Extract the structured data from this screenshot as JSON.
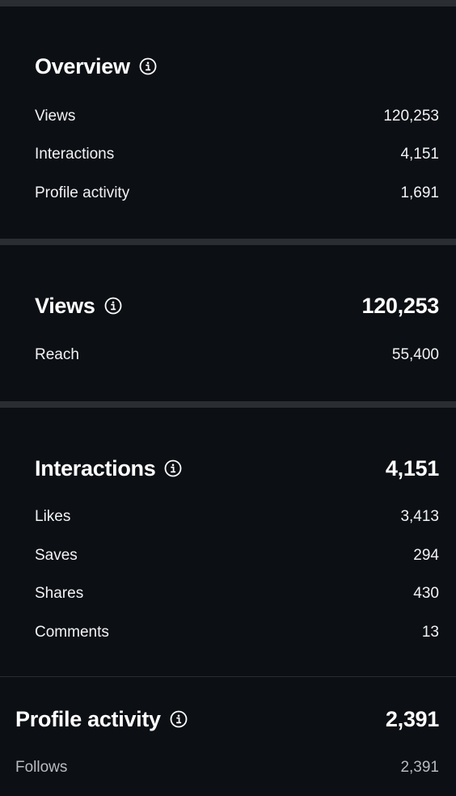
{
  "overview": {
    "title": "Overview",
    "rows": [
      {
        "label": "Views",
        "value": "120,253"
      },
      {
        "label": "Interactions",
        "value": "4,151"
      },
      {
        "label": "Profile activity",
        "value": "1,691"
      }
    ]
  },
  "views": {
    "title": "Views",
    "total": "120,253",
    "rows": [
      {
        "label": "Reach",
        "value": "55,400"
      }
    ]
  },
  "interactions": {
    "title": "Interactions",
    "total": "4,151",
    "rows": [
      {
        "label": "Likes",
        "value": "3,413"
      },
      {
        "label": "Saves",
        "value": "294"
      },
      {
        "label": "Shares",
        "value": "430"
      },
      {
        "label": "Comments",
        "value": "13"
      }
    ]
  },
  "profile_activity": {
    "title": "Profile activity",
    "total": "2,391",
    "rows": [
      {
        "label": "Follows",
        "value": "2,391"
      }
    ]
  },
  "icons": {
    "info": "info-circle-icon"
  },
  "colors": {
    "background": "#0c0f14",
    "divider": "#2a2d31",
    "text": "#ffffff",
    "muted_text": "#b9bcc1"
  }
}
